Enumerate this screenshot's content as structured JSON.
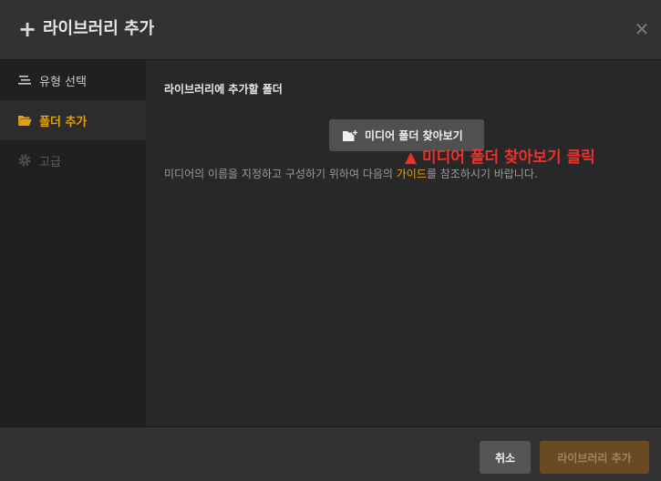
{
  "header": {
    "title": "라이브러리 추가",
    "plus_icon": "plus-icon",
    "close_icon": "close-icon"
  },
  "sidebar": {
    "items": [
      {
        "label": "유형 선택",
        "icon": "list-icon",
        "state": "normal"
      },
      {
        "label": "폴더 추가",
        "icon": "folder-open-icon",
        "state": "active"
      },
      {
        "label": "고급",
        "icon": "gear-icon",
        "state": "disabled"
      }
    ]
  },
  "main": {
    "section_title": "라이브러리에 추가할 폴더",
    "browse_button": "미디어 폴더 찾아보기",
    "browse_icon": "folder-add-icon",
    "annotation": "▲ 미디어 폴더 찾아보기 클릭",
    "help": {
      "before": "미디어의 이름을 지정하고 구성하기 위하여 다음의 ",
      "link": "가이드",
      "after": "를 참조하시기 바랍니다."
    }
  },
  "footer": {
    "cancel_label": "취소",
    "add_label": "라이브러리 추가"
  },
  "colors": {
    "accent": "#e5a00d",
    "annotation": "#e8322b",
    "background": "#262626",
    "header": "#323232",
    "sidebar": "#202020",
    "add_button": "#6a4a22"
  }
}
